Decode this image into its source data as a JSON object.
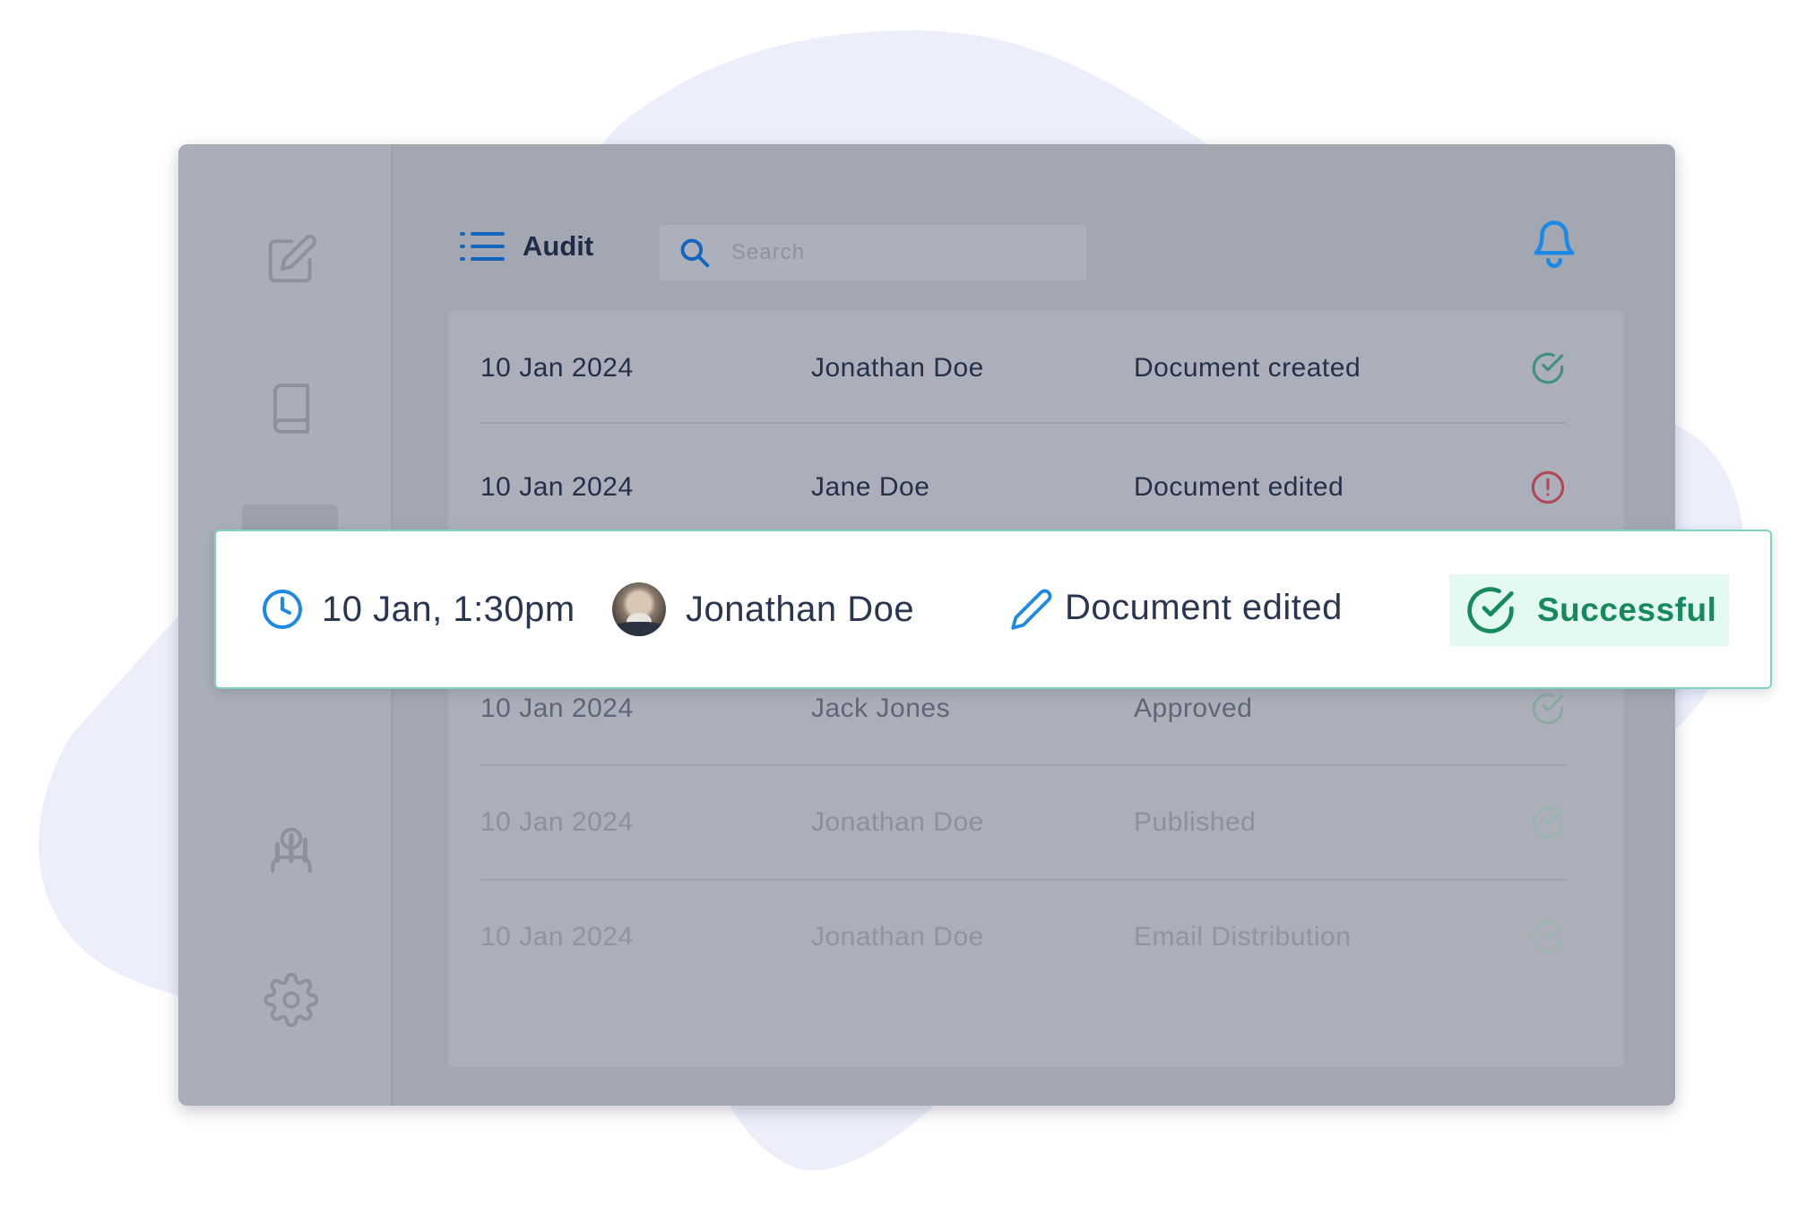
{
  "header": {
    "title": "Audit",
    "menu_icon": "list-icon",
    "notification_icon": "bell-icon"
  },
  "search": {
    "placeholder": "Search"
  },
  "sidebar": {
    "items": [
      {
        "icon": "edit-icon"
      },
      {
        "icon": "book-icon"
      },
      {
        "icon": "grid-icon",
        "active": true
      },
      {
        "icon": "bar-chart-icon"
      },
      {
        "icon": "user-icon"
      },
      {
        "icon": "settings-icon"
      }
    ]
  },
  "audit_rows": [
    {
      "date": "10 Jan 2024",
      "user": "Jonathan Doe",
      "action": "Document created",
      "status": "success"
    },
    {
      "date": "10 Jan 2024",
      "user": "Jane Doe",
      "action": "Document edited",
      "status": "error"
    },
    {
      "date": "10 Jan 2024",
      "user": "Jack Jones",
      "action": "Approved",
      "status": "success"
    },
    {
      "date": "10 Jan 2024",
      "user": "Jonathan Doe",
      "action": "Published",
      "status": "success"
    },
    {
      "date": "10 Jan 2024",
      "user": "Jonathan Doe",
      "action": "Email Distribution",
      "status": "success"
    }
  ],
  "highlight_card": {
    "time": "10 Jan, 1:30pm",
    "user": "Jonathan Doe",
    "action": "Document edited",
    "status_label": "Successful"
  },
  "colors": {
    "accent_blue": "#1e88e5",
    "success_green": "#168a5c",
    "success_bg": "#e3f9f1",
    "error_red": "#b0485a",
    "card_border": "#7fd3c6",
    "blob": "#eceffb"
  }
}
